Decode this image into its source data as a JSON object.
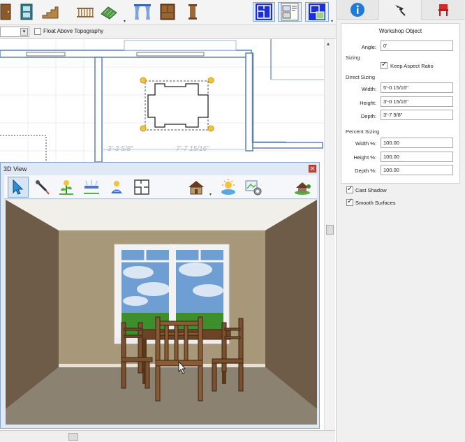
{
  "toolbar": {
    "icons": [
      "door-tool-icon",
      "window-tool-icon",
      "stairs-tool-icon",
      "railing-tool-icon",
      "terrain-tool-icon",
      "curtain-tool-icon",
      "cabinet-tool-icon",
      "column-tool-icon",
      "floor-plan-view-icon",
      "layout-view-icon",
      "elevation-view-icon"
    ]
  },
  "options": {
    "combo_value": "",
    "float_label": "Float Above Topography",
    "float_checked": false
  },
  "plan": {
    "dim1": "3'-3 5/8\"",
    "dim2": "7'-7 15/16\""
  },
  "view3d": {
    "title": "3D View",
    "close_label": "✕",
    "tools": [
      "select-arrow-icon",
      "eyedropper-icon",
      "plant-icon",
      "sprinkler-icon",
      "light-icon",
      "floor-plan-icon",
      "house-icon",
      "sun-icon",
      "render-settings-icon",
      "exterior-view-icon"
    ]
  },
  "panel": {
    "tabs": [
      "info-tab",
      "object-tab",
      "furniture-tab"
    ],
    "object_title": "Workshop Object",
    "angle_label": "Angle:",
    "angle_value": "0'",
    "sizing_label": "Sizing",
    "keep_aspect_label": "Keep Aspect Ratio",
    "keep_aspect_checked": true,
    "direct_sizing_label": "Direct Sizing",
    "width_label": "Width:",
    "width_value": "5'-0 15/16\"",
    "height_label": "Height:",
    "height_value": "3'-0 15/16\"",
    "depth_label": "Depth:",
    "depth_value": "3'-7 9/8\"",
    "percent_sizing_label": "Percent Sizing",
    "width_pct_label": "Width %:",
    "width_pct_value": "100.00",
    "height_pct_label": "Height %:",
    "height_pct_value": "100.00",
    "depth_pct_label": "Depth %:",
    "depth_pct_value": "100.00",
    "cast_shadow_label": "Cast Shadow",
    "cast_shadow_checked": true,
    "smooth_surfaces_label": "Smooth Surfaces",
    "smooth_surfaces_checked": true
  },
  "colors": {
    "accent_blue": "#1e7bd6",
    "tab_red": "#d42a2a",
    "wall_blue": "#5b7fc0",
    "panel_bg": "#f0f0f0"
  }
}
